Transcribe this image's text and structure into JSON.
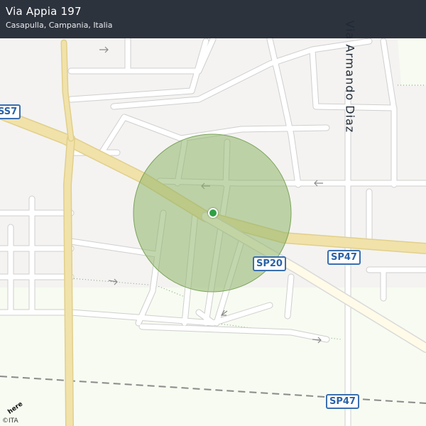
{
  "header": {
    "title": "Via Appia 197",
    "subtitle": "Casapulla, Campania, Italia"
  },
  "road_labels": {
    "ss7": "SS7",
    "sp20": "SP20",
    "sp47_upper": "SP47",
    "sp47_lower": "SP47",
    "street_name": "Via Armando Diaz"
  },
  "map": {
    "location_marker": {
      "icon": "location-dot-icon",
      "color": "#2ea043"
    },
    "accuracy_circle_color": "#8fb56a",
    "major_road_color": "#f1e2aa",
    "railway_color": "#8a8a8a"
  },
  "branding": {
    "logo_text": "here",
    "attribution": "©ITA"
  }
}
